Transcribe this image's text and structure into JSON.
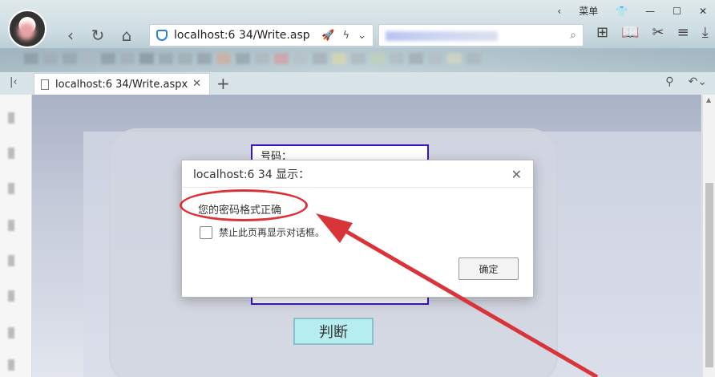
{
  "browser": {
    "menu_label": "菜单",
    "address": "localhost:6 34/Write.asp",
    "tab_title": "localhost:6 34/Write.aspx",
    "icons": [
      "back-icon",
      "refresh-icon",
      "home-icon",
      "shield-icon",
      "rocket-icon",
      "bolt-icon",
      "search-icon",
      "grid-icon",
      "reader-icon",
      "scissors-icon",
      "download-icon",
      "pin-icon",
      "undo-icon"
    ]
  },
  "page": {
    "field_label": "号码：",
    "judge_button": "判断"
  },
  "dialog": {
    "title": "localhost:6 34 显示：",
    "message": "您的密码格式正确",
    "checkbox_label": "禁止此页再显示对话框。",
    "ok_button": "确定",
    "checkbox_checked": false
  },
  "colors": {
    "annotation": "#d9343a",
    "box_border": "#3a16c6",
    "judge_bg": "#b6eef0"
  }
}
